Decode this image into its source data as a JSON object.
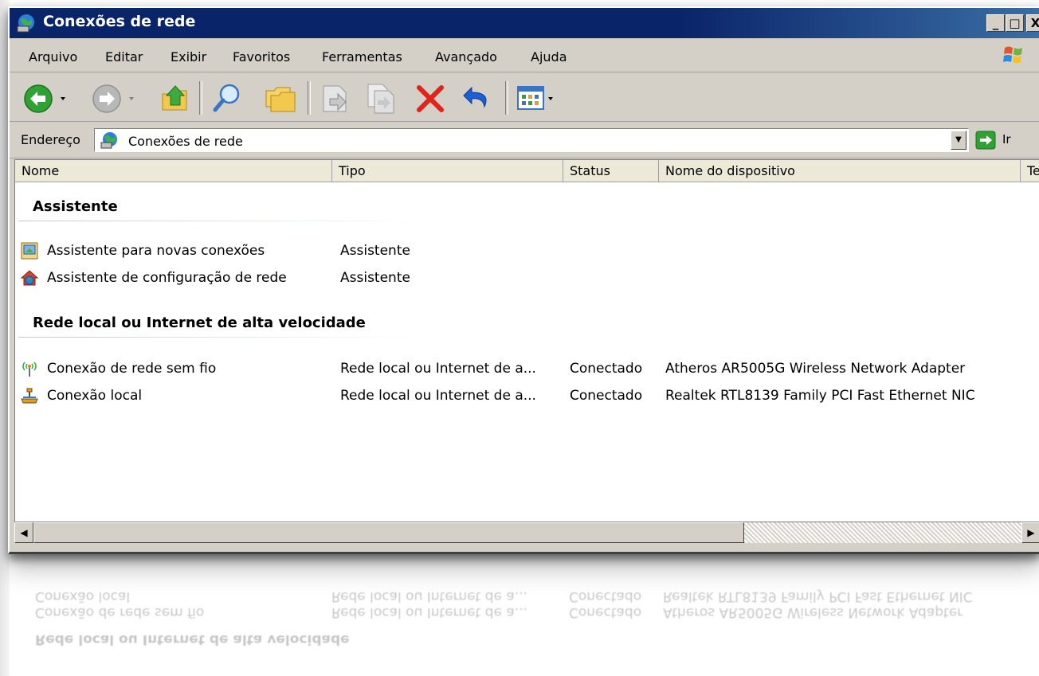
{
  "window": {
    "title": "Conexões de rede",
    "controls": {
      "minimize": "_",
      "maximize": "□",
      "close": "X"
    }
  },
  "menu": [
    "Arquivo",
    "Editar",
    "Exibir",
    "Favoritos",
    "Ferramentas",
    "Avançado",
    "Ajuda"
  ],
  "toolbar": {
    "icons": [
      "back-icon",
      "forward-icon",
      "up-folder-icon",
      "search-icon",
      "folders-icon",
      "move-to-icon",
      "copy-to-icon",
      "delete-icon",
      "undo-icon",
      "views-icon"
    ]
  },
  "address": {
    "label": "Endereço",
    "value": "Conexões de rede",
    "go_label": "Ir"
  },
  "columns": [
    "Nome",
    "Tipo",
    "Status",
    "Nome do dispositivo",
    "Te"
  ],
  "groups": [
    {
      "title": "Assistente",
      "items": [
        {
          "name": "Assistente para novas conexões",
          "type": "Assistente",
          "status": "",
          "device": "",
          "icon": "new-connection-wizard-icon"
        },
        {
          "name": "Assistente de configuração de rede",
          "type": "Assistente",
          "status": "",
          "device": "",
          "icon": "network-setup-wizard-icon"
        }
      ]
    },
    {
      "title": "Rede local ou Internet de alta velocidade",
      "items": [
        {
          "name": "Conexão de rede sem fio",
          "type": "Rede local ou Internet de a...",
          "status": "Conectado",
          "device": "Atheros AR5005G Wireless Network Adapter",
          "icon": "wireless-icon"
        },
        {
          "name": "Conexão local",
          "type": "Rede local ou Internet de a...",
          "status": "Conectado",
          "device": "Realtek RTL8139 Family PCI Fast Ethernet NIC",
          "icon": "lan-icon"
        }
      ]
    }
  ],
  "scrollbar": {
    "left_arrow": "◀",
    "right_arrow": "▶"
  },
  "colors": {
    "titlebar": "#0a246a",
    "face": "#d4d0c8",
    "delete_red": "#e0231b",
    "undo_blue": "#1a5fd6",
    "group_line": "#b8cbe8"
  }
}
